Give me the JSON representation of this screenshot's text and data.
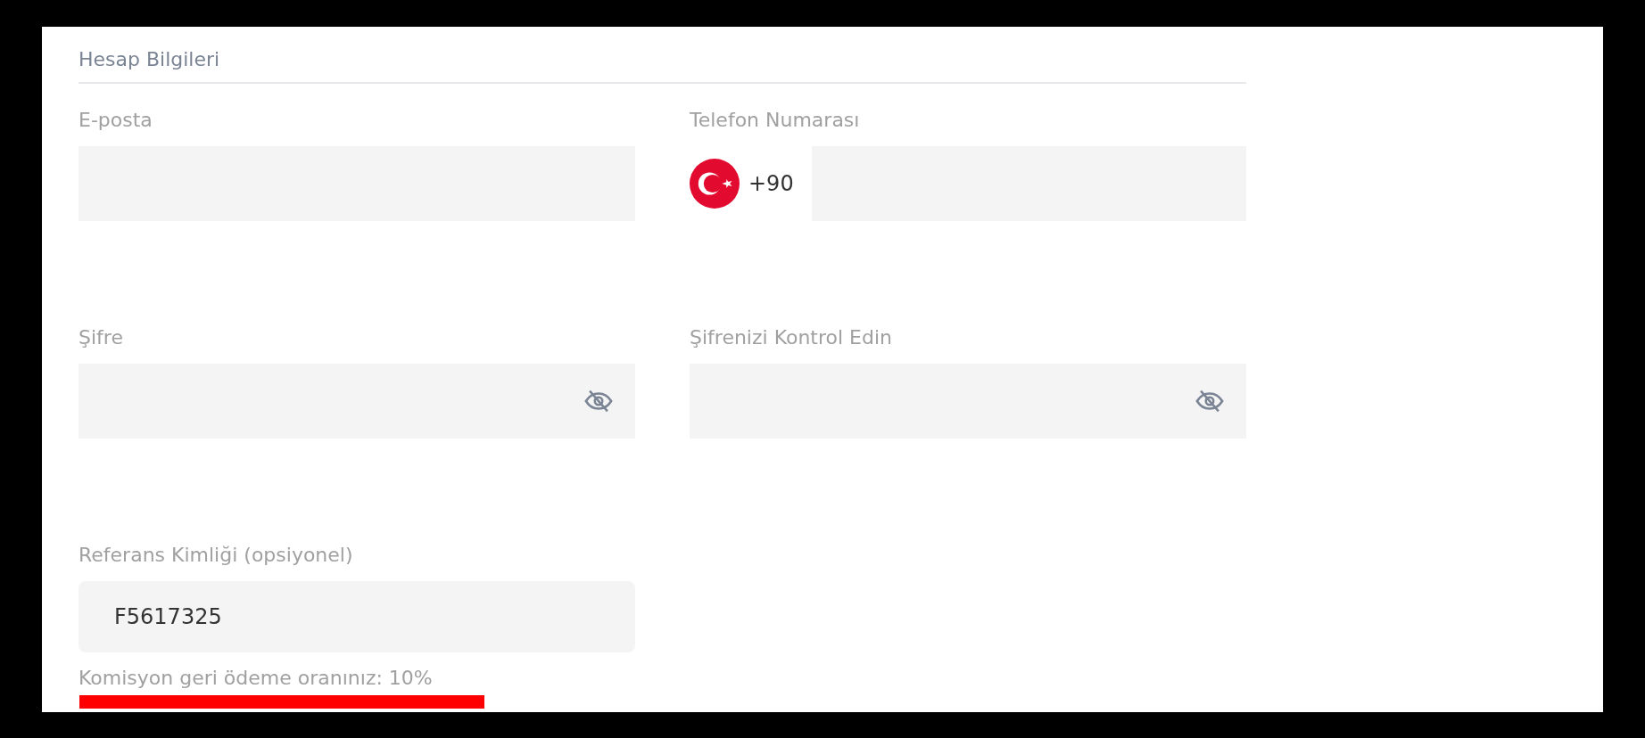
{
  "section_title": "Hesap Bilgileri",
  "fields": [
    {
      "kind": "text",
      "label": "E-posta"
    },
    {
      "kind": "phone",
      "label": "Telefon Numarası",
      "country_code": "+90"
    },
    {
      "kind": "password",
      "label": "Şifre"
    },
    {
      "kind": "password",
      "label": "Şifrenizi Kontrol Edin"
    },
    {
      "kind": "text",
      "label": "Referans Kimliği (opsiyonel)",
      "value": "F5617325"
    }
  ],
  "hint": "Komisyon geri ödeme oranınız: 10%"
}
